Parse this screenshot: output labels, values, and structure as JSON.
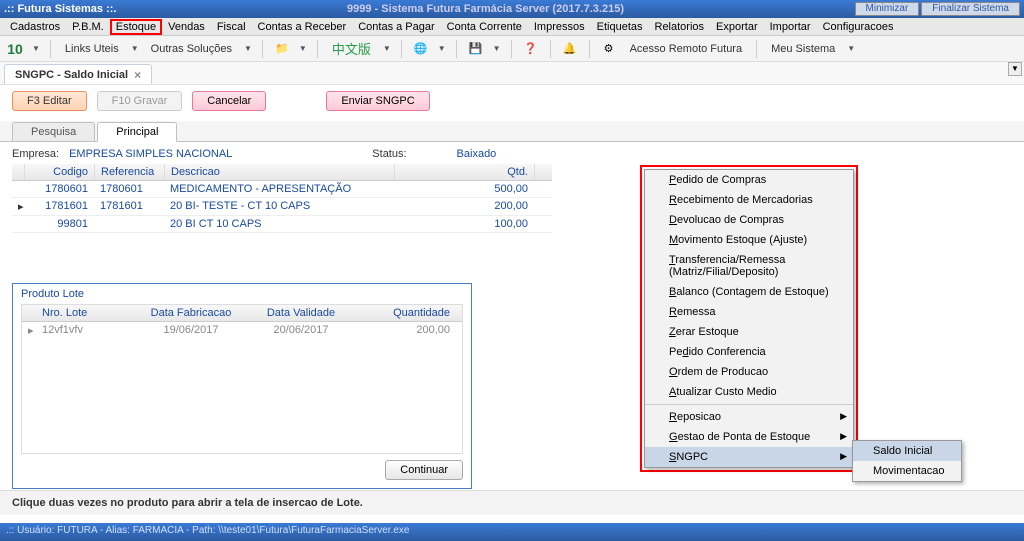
{
  "titlebar": {
    "app": ".:: Futura Sistemas ::.",
    "subtitle": "9999 - Sistema Futura Farmácia Server (2017.7.3.215)",
    "minimize": "Minimizar",
    "close": "Finalizar Sistema"
  },
  "menubar": [
    "Cadastros",
    "P.B.M.",
    "Estoque",
    "Vendas",
    "Fiscal",
    "Contas a Receber",
    "Contas a Pagar",
    "Conta Corrente",
    "Impressos",
    "Etiquetas",
    "Relatorios",
    "Exportar",
    "Importar",
    "Configuracoes"
  ],
  "toolbar": {
    "ten": "10",
    "links": "Links Uteis",
    "solucoes": "Outras Soluções",
    "chinese": "中文版",
    "acesso": "Acesso Remoto Futura",
    "meu": "Meu Sistema"
  },
  "tab": {
    "title": "SNGPC - Saldo Inicial"
  },
  "actions": {
    "edit": "F3 Editar",
    "save": "F10 Gravar",
    "cancel": "Cancelar",
    "send": "Enviar SNGPC"
  },
  "subtabs": [
    "Pesquisa",
    "Principal"
  ],
  "form": {
    "empresaLabel": "Empresa:",
    "empresaValue": "EMPRESA SIMPLES NACIONAL",
    "statusLabel": "Status:",
    "statusValue": "Baixado"
  },
  "grid": {
    "headers": [
      "Codigo",
      "Referencia",
      "Descricao",
      "Qtd."
    ],
    "rows": [
      {
        "ind": "",
        "codigo": "1780601",
        "ref": "1780601",
        "desc": "MEDICAMENTO - APRESENTAÇÃO",
        "qtd": "500,00"
      },
      {
        "ind": "▸",
        "codigo": "1781601",
        "ref": "1781601",
        "desc": "20 BI- TESTE - CT 10 CAPS",
        "qtd": "200,00"
      },
      {
        "ind": "",
        "codigo": "99801",
        "ref": "",
        "desc": "20 BI CT 10 CAPS",
        "qtd": "100,00"
      }
    ]
  },
  "lote": {
    "title": "Produto Lote",
    "headers": [
      "Nro. Lote",
      "Data Fabricacao",
      "Data Validade",
      "Quantidade"
    ],
    "row": {
      "ind": "▸",
      "nro": "12vf1vfv",
      "fab": "19/06/2017",
      "val": "20/06/2017",
      "qtd": "200,00"
    },
    "continuar": "Continuar"
  },
  "ctx": [
    {
      "label": "Pedido de Compras",
      "u": "P"
    },
    {
      "label": "Recebimento de Mercadorias",
      "u": "R"
    },
    {
      "label": "Devolucao de Compras",
      "u": "D"
    },
    {
      "label": "Movimento Estoque (Ajuste)",
      "u": "M"
    },
    {
      "label": "Transferencia/Remessa (Matriz/Filial/Deposito)",
      "u": "T"
    },
    {
      "label": "Balanco (Contagem de Estoque)",
      "u": "B"
    },
    {
      "label": "Remessa",
      "u": "R"
    },
    {
      "label": "Zerar Estoque",
      "u": "Z"
    },
    {
      "label": "Pedido Conferencia",
      "u": "d"
    },
    {
      "label": "Ordem de Producao",
      "u": "O"
    },
    {
      "label": "Atualizar Custo Medio",
      "u": "A"
    },
    {
      "label": "Reposicao",
      "u": "R",
      "arrow": true,
      "sep": true
    },
    {
      "label": "Gestao de Ponta de Estoque",
      "u": "G",
      "arrow": true
    },
    {
      "label": "SNGPC",
      "u": "S",
      "arrow": true,
      "sel": true
    }
  ],
  "submenu": [
    {
      "label": "Saldo Inicial",
      "u": "S",
      "sel": true
    },
    {
      "label": "Movimentacao",
      "u": "M"
    }
  ],
  "hint": "Clique duas vezes no produto para abrir a tela de insercao de Lote.",
  "status": ".:: Usuário: FUTURA - Alias: FARMACIA - Path: \\\\teste01\\Futura\\FuturaFarmaciaServer.exe"
}
